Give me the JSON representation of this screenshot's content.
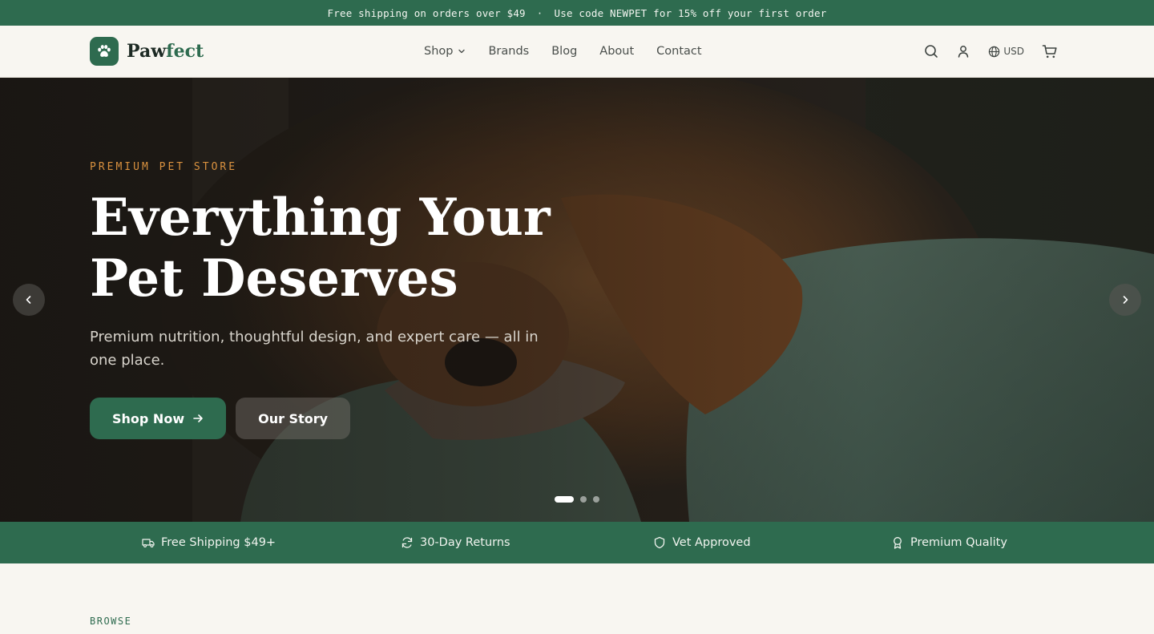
{
  "announcement": {
    "shipping": "Free shipping on orders over $49",
    "separator": "·",
    "promo": "Use code NEWPET for 15% off your first order"
  },
  "brand": {
    "name_part1": "Paw",
    "name_part2": "fect",
    "logo_icon": "paw-icon"
  },
  "nav": {
    "shop": "Shop",
    "brands": "Brands",
    "blog": "Blog",
    "about": "About",
    "contact": "Contact"
  },
  "header_actions": {
    "search_icon": "search-icon",
    "account_icon": "user-icon",
    "currency": "USD",
    "cart_icon": "cart-icon"
  },
  "hero": {
    "eyebrow": "PREMIUM PET STORE",
    "title_line1": "Everything Your",
    "title_line2": "Pet Deserves",
    "subtitle": "Premium nutrition, thoughtful design, and expert care — all in one place.",
    "primary_button": "Shop Now",
    "secondary_button": "Our Story",
    "slides": 3,
    "active_slide": 1
  },
  "features": [
    {
      "icon": "truck-icon",
      "label": "Free Shipping $49+"
    },
    {
      "icon": "refresh-icon",
      "label": "30-Day Returns"
    },
    {
      "icon": "shield-icon",
      "label": "Vet Approved"
    },
    {
      "icon": "award-icon",
      "label": "Premium Quality"
    }
  ],
  "browse": {
    "eyebrow": "BROWSE"
  },
  "colors": {
    "brand_green": "#2e6b4f",
    "accent_orange": "#d9913f",
    "background": "#f8f6f1"
  }
}
